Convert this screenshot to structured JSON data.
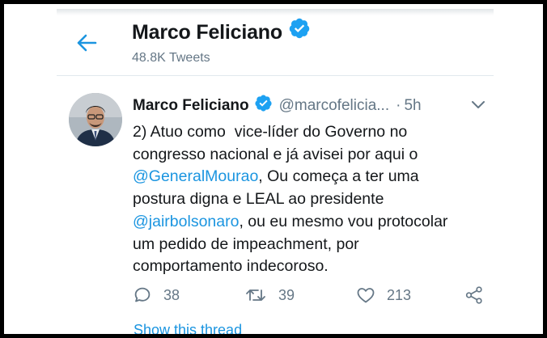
{
  "header": {
    "back_label": "Back",
    "title": "Marco Feliciano",
    "tweet_count": "48.8K Tweets"
  },
  "tweet": {
    "author_name": "Marco Feliciano",
    "handle": "@marcofelicia...",
    "separator": "·",
    "time": "5h",
    "text_lines": [
      "2) Atuo como  vice-líder do Governo no",
      "congresso nacional e já avisei por aqui o",
      ", Ou começa a ter uma",
      "postura digna e LEAL ao presidente",
      ", ou eu mesmo vou protocolar",
      "um pedido de impeachment, por",
      "comportamento indecoroso."
    ],
    "mention_1": "@GeneralMourao",
    "mention_2": "@jairbolsonaro",
    "replies": "38",
    "retweets": "39",
    "likes": "213",
    "show_thread": "Show this thread"
  },
  "colors": {
    "accent": "#1b95e0",
    "text": "#14171a",
    "secondary": "#657786",
    "verified": "#1da1f2"
  },
  "icons": [
    "back-arrow-icon",
    "verified-icon",
    "chevron-down-icon",
    "reply-icon",
    "retweet-icon",
    "like-icon",
    "share-icon"
  ]
}
